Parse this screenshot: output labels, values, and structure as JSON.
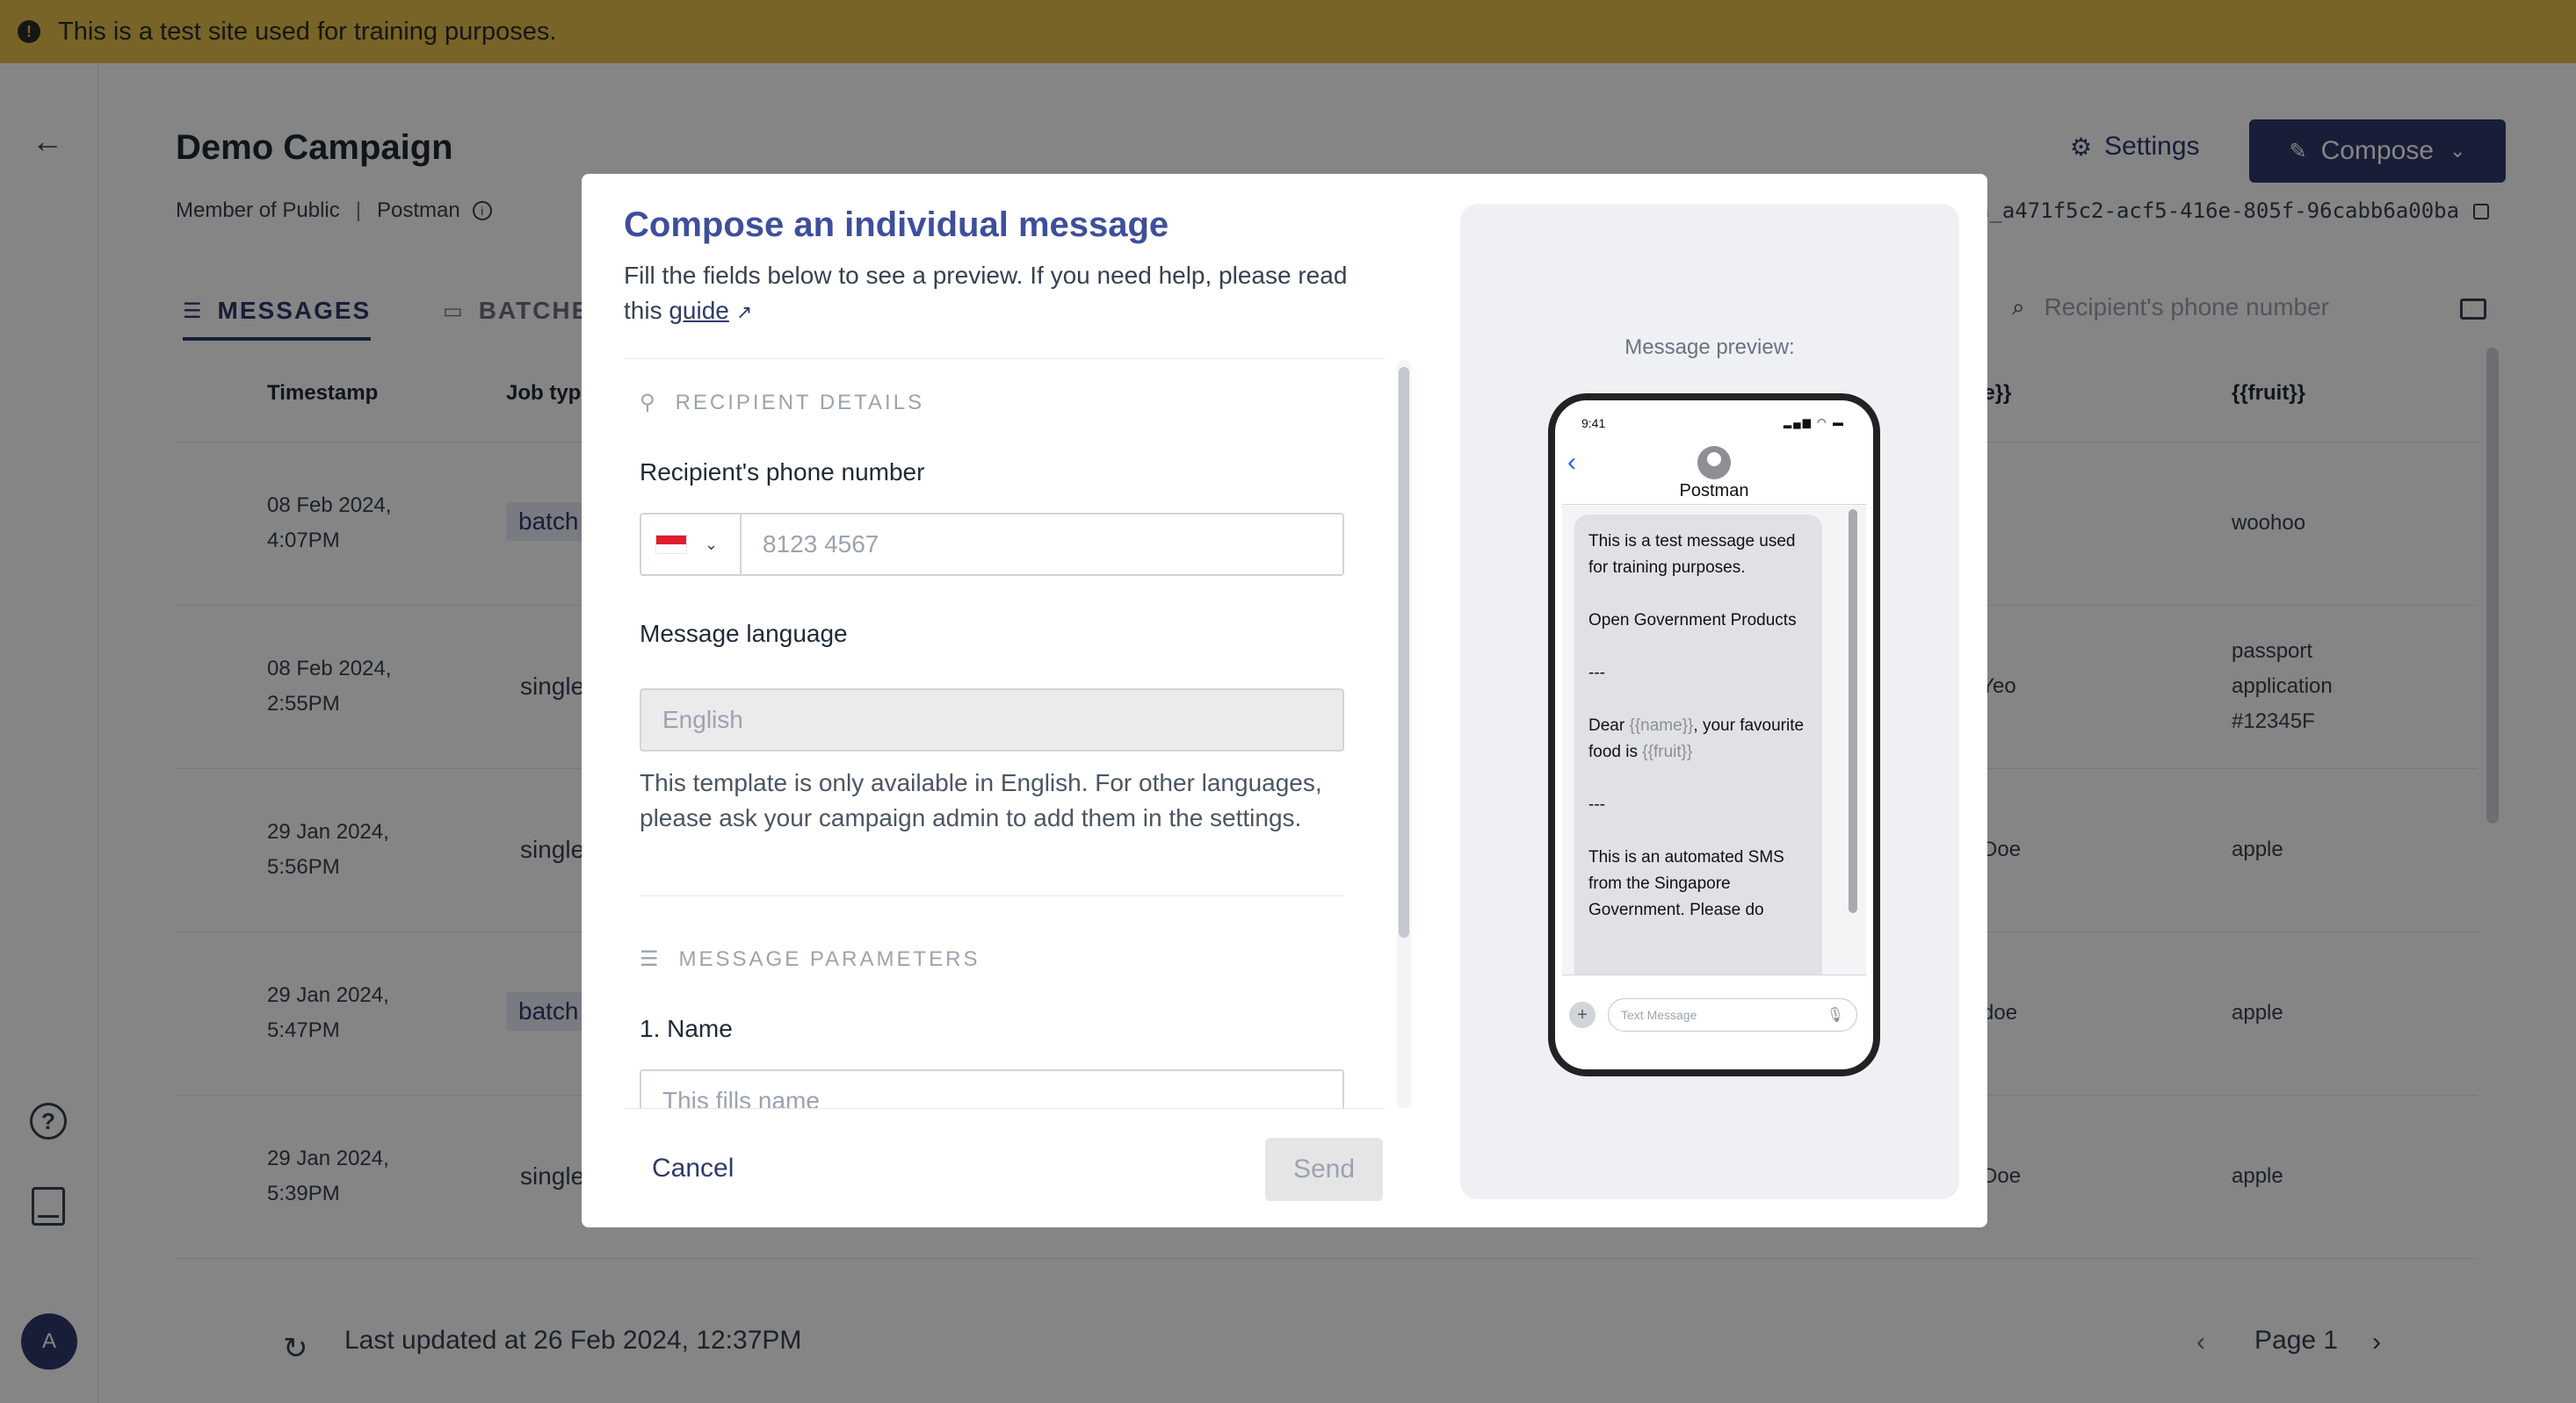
{
  "banner": {
    "text": "This is a test site used for training purposes."
  },
  "header": {
    "title": "Demo Campaign",
    "role": "Member of Public",
    "sender": "Postman",
    "settings_label": "Settings",
    "compose_label": "Compose",
    "campaign_id": "n_a471f5c2-acf5-416e-805f-96cabb6a00ba"
  },
  "tabs": {
    "messages": "MESSAGES",
    "batches": "BATCHE"
  },
  "search": {
    "placeholder": "Recipient's phone number"
  },
  "table": {
    "headers": {
      "timestamp": "Timestamp",
      "job_type": "Job typ",
      "name": "me}}",
      "fruit": "{{fruit}}"
    },
    "rows": [
      {
        "date": "08 Feb 2024,",
        "time": "4:07PM",
        "type": "batch",
        "name": "",
        "fruit": "woohoo"
      },
      {
        "date": "08 Feb 2024,",
        "time": "2:55PM",
        "type": "single",
        "name": "y Yeo",
        "fruit": "passport\napplication\n#12345F"
      },
      {
        "date": "29 Jan 2024,",
        "time": "5:56PM",
        "type": "single",
        "name": "n Doe",
        "fruit": "apple"
      },
      {
        "date": "29 Jan 2024,",
        "time": "5:47PM",
        "type": "batch",
        "name": "n doe",
        "fruit": "apple"
      },
      {
        "date": "29 Jan 2024,",
        "time": "5:39PM",
        "type": "single",
        "name": "n Doe",
        "fruit": "apple"
      }
    ]
  },
  "footer": {
    "updated": "Last updated at 26 Feb 2024, 12:37PM",
    "page": "Page 1"
  },
  "sidebar": {
    "avatar": "A"
  },
  "modal": {
    "title": "Compose an individual message",
    "desc_before": "Fill the fields below to see a preview. If you need help, please read this ",
    "guide_link": "guide",
    "recipient_section": "RECIPIENT DETAILS",
    "phone_label": "Recipient's phone number",
    "phone_placeholder": "8123 4567",
    "language_label": "Message language",
    "language_value": "English",
    "language_helper": "This template is only available in English. For other languages, please ask your campaign admin to add them in the settings.",
    "params_section": "MESSAGE PARAMETERS",
    "param_1_label": "1. Name",
    "param_1_placeholder": "This fills name",
    "cancel_label": "Cancel",
    "send_label": "Send"
  },
  "preview": {
    "label": "Message preview:",
    "status_time": "9:41",
    "contact_name": "Postman",
    "msg_part1": "This is a test message used for training purposes.\n\nOpen Government Products\n\n---\n\nDear ",
    "var_name": "{{name}}",
    "msg_part2": ", your favourite food is ",
    "var_fruit": "{{fruit}}",
    "msg_part3": "\n\n---\n\nThis is an automated SMS from the Singapore Government. Please do",
    "input_placeholder": "Text Message"
  }
}
